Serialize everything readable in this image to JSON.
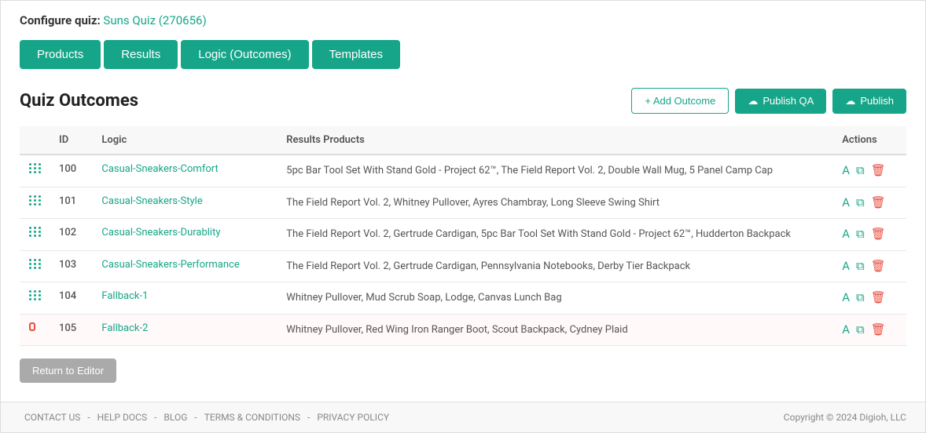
{
  "page": {
    "configure_label": "Configure quiz:",
    "quiz_name": "Suns Quiz (270656)"
  },
  "tabs": [
    {
      "id": "products",
      "label": "Products",
      "active": false
    },
    {
      "id": "results",
      "label": "Results",
      "active": false
    },
    {
      "id": "logic",
      "label": "Logic (Outcomes)",
      "active": true
    },
    {
      "id": "templates",
      "label": "Templates",
      "active": false
    }
  ],
  "section": {
    "title": "Quiz Outcomes",
    "add_outcome_label": "+ Add Outcome",
    "publish_qa_label": "Publish QA",
    "publish_label": "Publish"
  },
  "table": {
    "headers": [
      "",
      "ID",
      "Logic",
      "Results Products",
      "Actions"
    ],
    "rows": [
      {
        "id": "100",
        "logic": "Casual-Sneakers-Comfort",
        "results": "5pc Bar Tool Set With Stand Gold - Project 62™, The Field Report Vol. 2, Double Wall Mug, 5 Panel Camp Cap",
        "highlighted": false
      },
      {
        "id": "101",
        "logic": "Casual-Sneakers-Style",
        "results": "The Field Report Vol. 2, Whitney Pullover, Ayres Chambray, Long Sleeve Swing Shirt",
        "highlighted": false
      },
      {
        "id": "102",
        "logic": "Casual-Sneakers-Durablity",
        "results": "The Field Report Vol. 2, Gertrude Cardigan, 5pc Bar Tool Set With Stand Gold - Project 62™, Hudderton Backpack",
        "highlighted": false
      },
      {
        "id": "103",
        "logic": "Casual-Sneakers-Performance",
        "results": "The Field Report Vol. 2, Gertrude Cardigan, Pennsylvania Notebooks, Derby Tier Backpack",
        "highlighted": false
      },
      {
        "id": "104",
        "logic": "Fallback-1",
        "results": "Whitney Pullover, Mud Scrub Soap, Lodge, Canvas Lunch Bag",
        "highlighted": false
      },
      {
        "id": "105",
        "logic": "Fallback-2",
        "results": "Whitney Pullover, Red Wing Iron Ranger Boot, Scout Backpack, Cydney Plaid",
        "highlighted": true
      }
    ]
  },
  "return_button": "Return to Editor",
  "footer": {
    "links": [
      "CONTACT US",
      "HELP DOCS",
      "BLOG",
      "TERMS & CONDITIONS",
      "PRIVACY POLICY"
    ],
    "copyright": "Copyright © 2024 Digioh, LLC"
  }
}
